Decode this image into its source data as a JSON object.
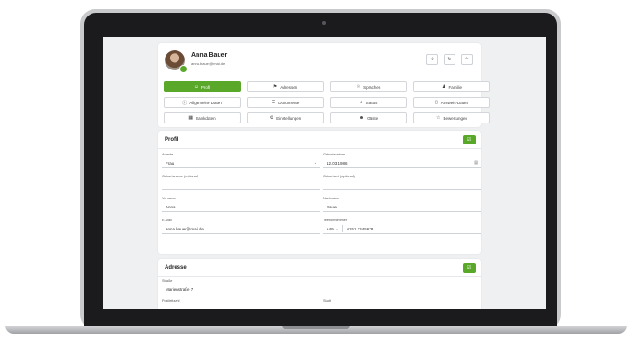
{
  "profile": {
    "name": "Anna Bauer",
    "email": "anna.bauer@mail.de"
  },
  "header_icons": [
    "bell-icon",
    "refresh-icon",
    "logout-icon"
  ],
  "tabs": [
    {
      "label": "Profil",
      "icon": "user-icon",
      "active": true
    },
    {
      "label": "Adressen",
      "icon": "map-icon",
      "active": false
    },
    {
      "label": "Sprachen",
      "icon": "globe-icon",
      "active": false
    },
    {
      "label": "Familie",
      "icon": "family-icon",
      "active": false
    },
    {
      "label": "Allgemeine Daten",
      "icon": "info-icon",
      "active": false
    },
    {
      "label": "Dokumente",
      "icon": "document-icon",
      "active": false
    },
    {
      "label": "Status",
      "icon": "status-icon",
      "active": false
    },
    {
      "label": "Ausweis-Daten",
      "icon": "id-card-icon",
      "active": false
    },
    {
      "label": "Bankdaten",
      "icon": "bank-icon",
      "active": false
    },
    {
      "label": "Einstellungen",
      "icon": "settings-icon",
      "active": false
    },
    {
      "label": "Gäste",
      "icon": "guests-icon",
      "active": false
    },
    {
      "label": "Bewertungen",
      "icon": "rating-icon",
      "active": false
    }
  ],
  "profile_section": {
    "title": "Profil",
    "save_icon": "save-icon",
    "fields": {
      "gender": {
        "label": "Anrede",
        "value": "Frau"
      },
      "birthdate": {
        "label": "Geburtsdatum",
        "value": "12.03.1986"
      },
      "birthname": {
        "label": "Geburtsname (optional)",
        "value": ""
      },
      "birthplace": {
        "label": "Geburtsort (optional)",
        "value": ""
      },
      "firstname": {
        "label": "Vorname",
        "value": "Anna"
      },
      "lastname": {
        "label": "Nachname",
        "value": "Bauer"
      },
      "email": {
        "label": "E-Mail",
        "value": "anna.bauer@mail.de"
      },
      "phone": {
        "label": "Telefonnummer",
        "prefix": "+49",
        "value": "0151 2345678"
      }
    }
  },
  "address_section": {
    "title": "Adresse",
    "save_icon": "save-icon",
    "fields": {
      "street": {
        "label": "Straße",
        "value": "Marienstraße 7"
      },
      "zip": {
        "label": "Postleitzahl"
      },
      "city": {
        "label": "Stadt"
      }
    }
  }
}
